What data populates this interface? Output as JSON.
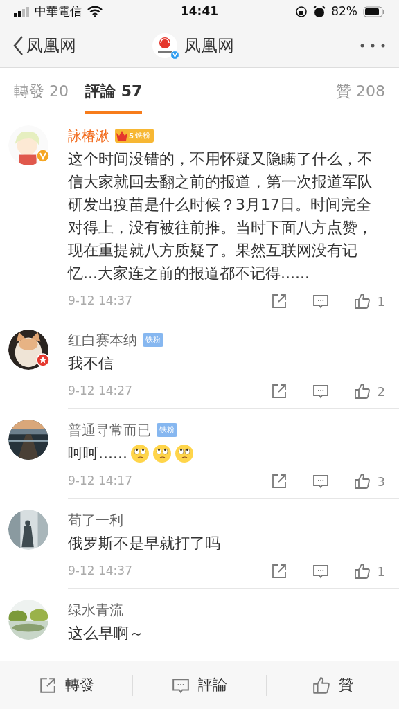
{
  "status_bar": {
    "carrier": "中華電信",
    "time": "14:41",
    "battery": "82%"
  },
  "nav": {
    "back_label": "凤凰网",
    "title": "凤凰网"
  },
  "tabs": [
    {
      "label": "轉發 20",
      "selected": false
    },
    {
      "label": "評論 57",
      "selected": true
    },
    {
      "label": "贊 208",
      "selected": false
    }
  ],
  "comments": [
    {
      "user": "詠椿湫",
      "highlighted": true,
      "avatar_badge": {
        "kind": "verified"
      },
      "fan_badge": {
        "kind": "gold",
        "label": "铁粉",
        "level": "5"
      },
      "text": "这个时间没错的，不用怀疑又隐瞒了什么，不信大家就回去翻之前的报道，第一次报道军队研发出疫苗是什么时候？3月17日。时间完全对得上，没有被往前推。当时下面八方点赞，现在重提就八方质疑了。果然互联网没有记忆...大家连之前的报道都不记得......",
      "time": "9-12 14:37",
      "likes": "1"
    },
    {
      "user": "红白赛本纳",
      "highlighted": false,
      "avatar_badge": {
        "kind": "star"
      },
      "fan_badge": {
        "kind": "blue",
        "label": "铁粉"
      },
      "text": "我不信",
      "time": "9-12 14:27",
      "likes": "2"
    },
    {
      "user": "普通寻常而已",
      "highlighted": false,
      "fan_badge": {
        "kind": "blue",
        "label": "铁粉"
      },
      "text": "呵呵......",
      "emojis": [
        {
          "kind": "eye-roll"
        },
        {
          "kind": "eye-roll"
        },
        {
          "kind": "eye-roll"
        }
      ],
      "time": "9-12 14:17",
      "likes": "3"
    },
    {
      "user": "苟了一利",
      "highlighted": false,
      "text": "俄罗斯不是早就打了吗",
      "time": "9-12 14:37",
      "likes": "1"
    },
    {
      "user": "绿水青流",
      "highlighted": false,
      "text": "这么早啊～"
    }
  ],
  "bottom_bar": [
    {
      "kind": "repost",
      "label": "轉發"
    },
    {
      "kind": "comment",
      "label": "評論"
    },
    {
      "kind": "like",
      "label": "贊"
    }
  ]
}
